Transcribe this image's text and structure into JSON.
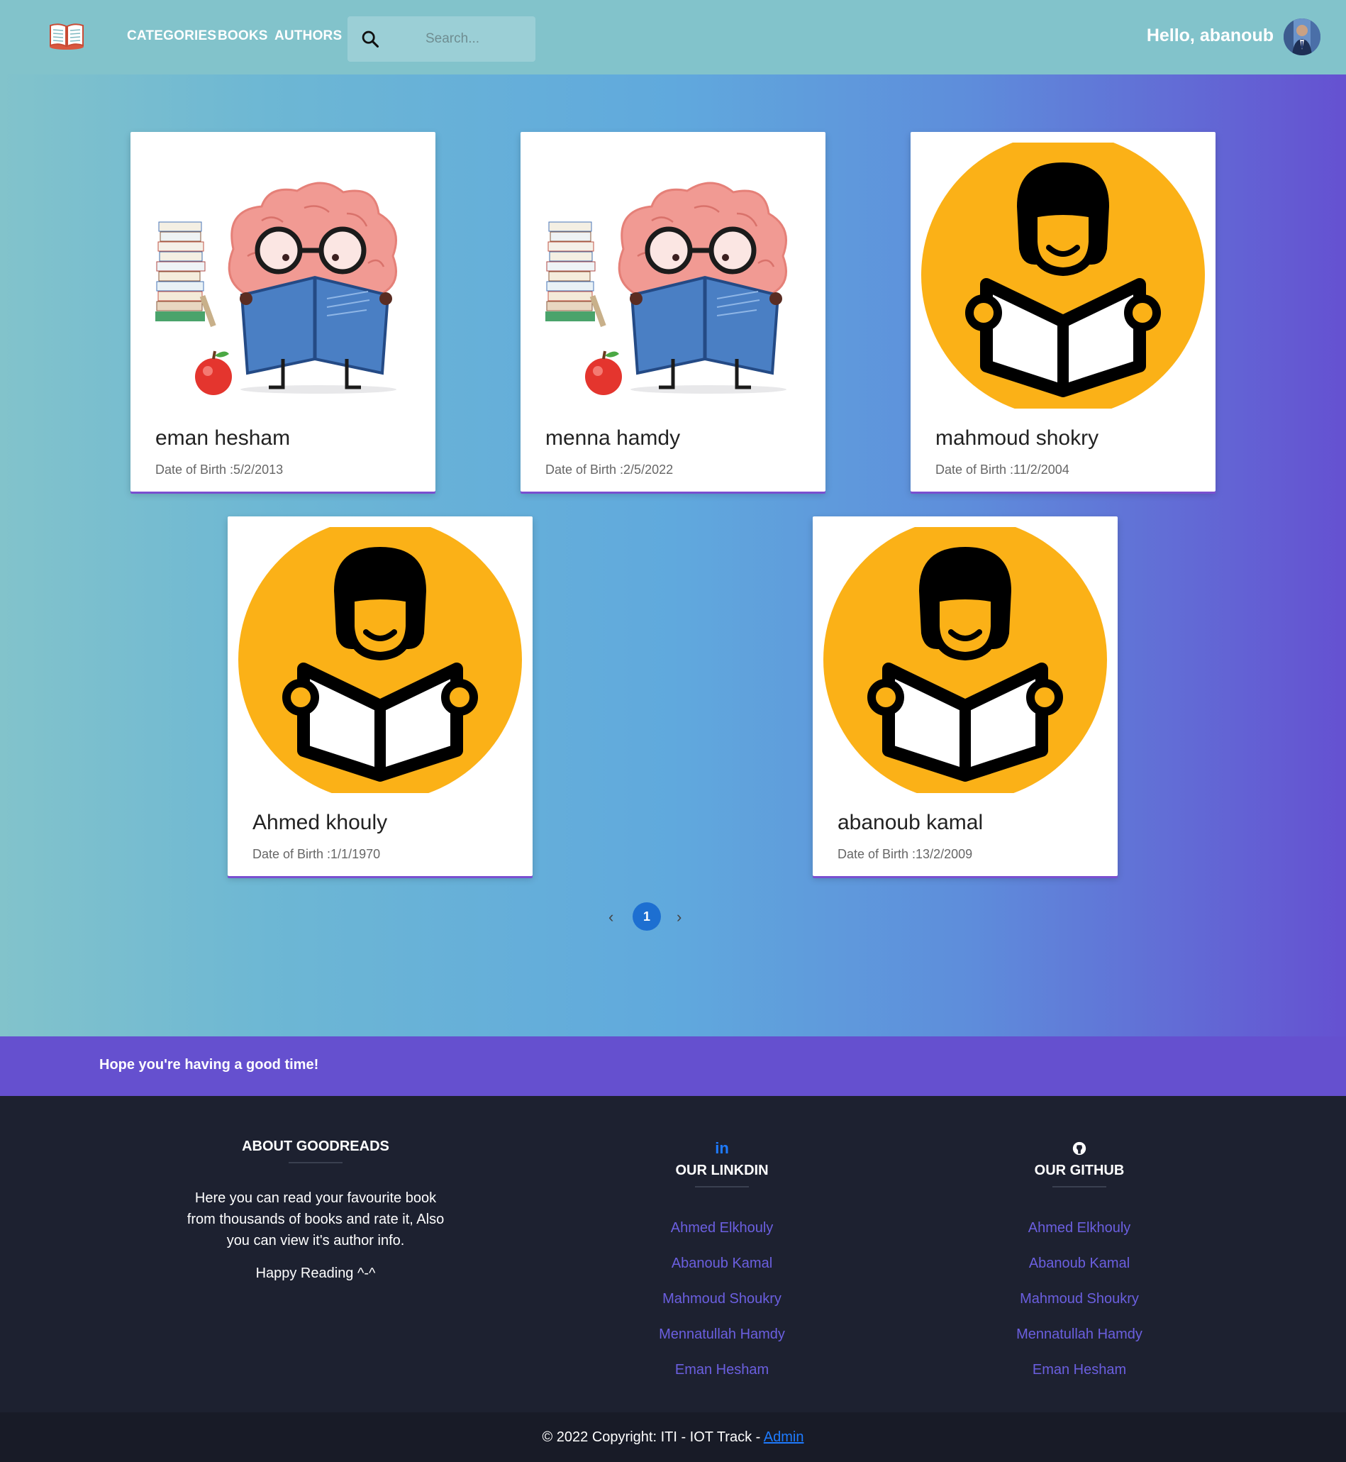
{
  "nav": {
    "links": [
      "CATEGORIES",
      "BOOKS",
      "AUTHORS"
    ],
    "search_placeholder": "Search...",
    "greeting": "Hello, abanoub"
  },
  "authors": [
    {
      "name": "eman hesham",
      "dob": "Date of Birth :5/2/2013",
      "image": "brain-reading-illustration"
    },
    {
      "name": "menna hamdy",
      "dob": "Date of Birth :2/5/2022",
      "image": "brain-reading-illustration"
    },
    {
      "name": "mahmoud shokry",
      "dob": "Date of Birth :11/2/2004",
      "image": "reader-icon"
    },
    {
      "name": "Ahmed khouly",
      "dob": "Date of Birth :1/1/1970",
      "image": "reader-icon"
    },
    {
      "name": "abanoub kamal",
      "dob": "Date of Birth :13/2/2009",
      "image": "reader-icon"
    }
  ],
  "pagination": {
    "prev": "‹",
    "current": "1",
    "next": "›"
  },
  "band": {
    "text": "Hope you're having a good time!"
  },
  "footer": {
    "about": {
      "title": "ABOUT GOODREADS",
      "text_lines": [
        "Here you can read your favourite book",
        "from thousands of books and rate it, Also",
        "you can view it's author info."
      ],
      "happy": "Happy Reading ^-^"
    },
    "linkedin": {
      "icon": "in",
      "title": "OUR LINKDIN",
      "links": [
        "Ahmed Elkhouly",
        "Abanoub Kamal",
        "Mahmoud Shoukry",
        "Mennatullah Hamdy",
        "Eman Hesham"
      ]
    },
    "github": {
      "title": "OUR GITHUB",
      "links": [
        "Ahmed Elkhouly",
        "Abanoub Kamal",
        "Mahmoud Shoukry",
        "Mennatullah Hamdy",
        "Eman Hesham"
      ]
    },
    "copyright_text": "© 2022 Copyright: ITI - IOT Track - ",
    "admin_link": "Admin"
  },
  "colors": {
    "navbar": "#82c3cb",
    "accent_purple": "#6550cf",
    "footer_bg": "#1d2130",
    "link_purple": "#6b5fe0",
    "page_active": "#1d6fd1",
    "reader_yellow": "#fbb117"
  }
}
